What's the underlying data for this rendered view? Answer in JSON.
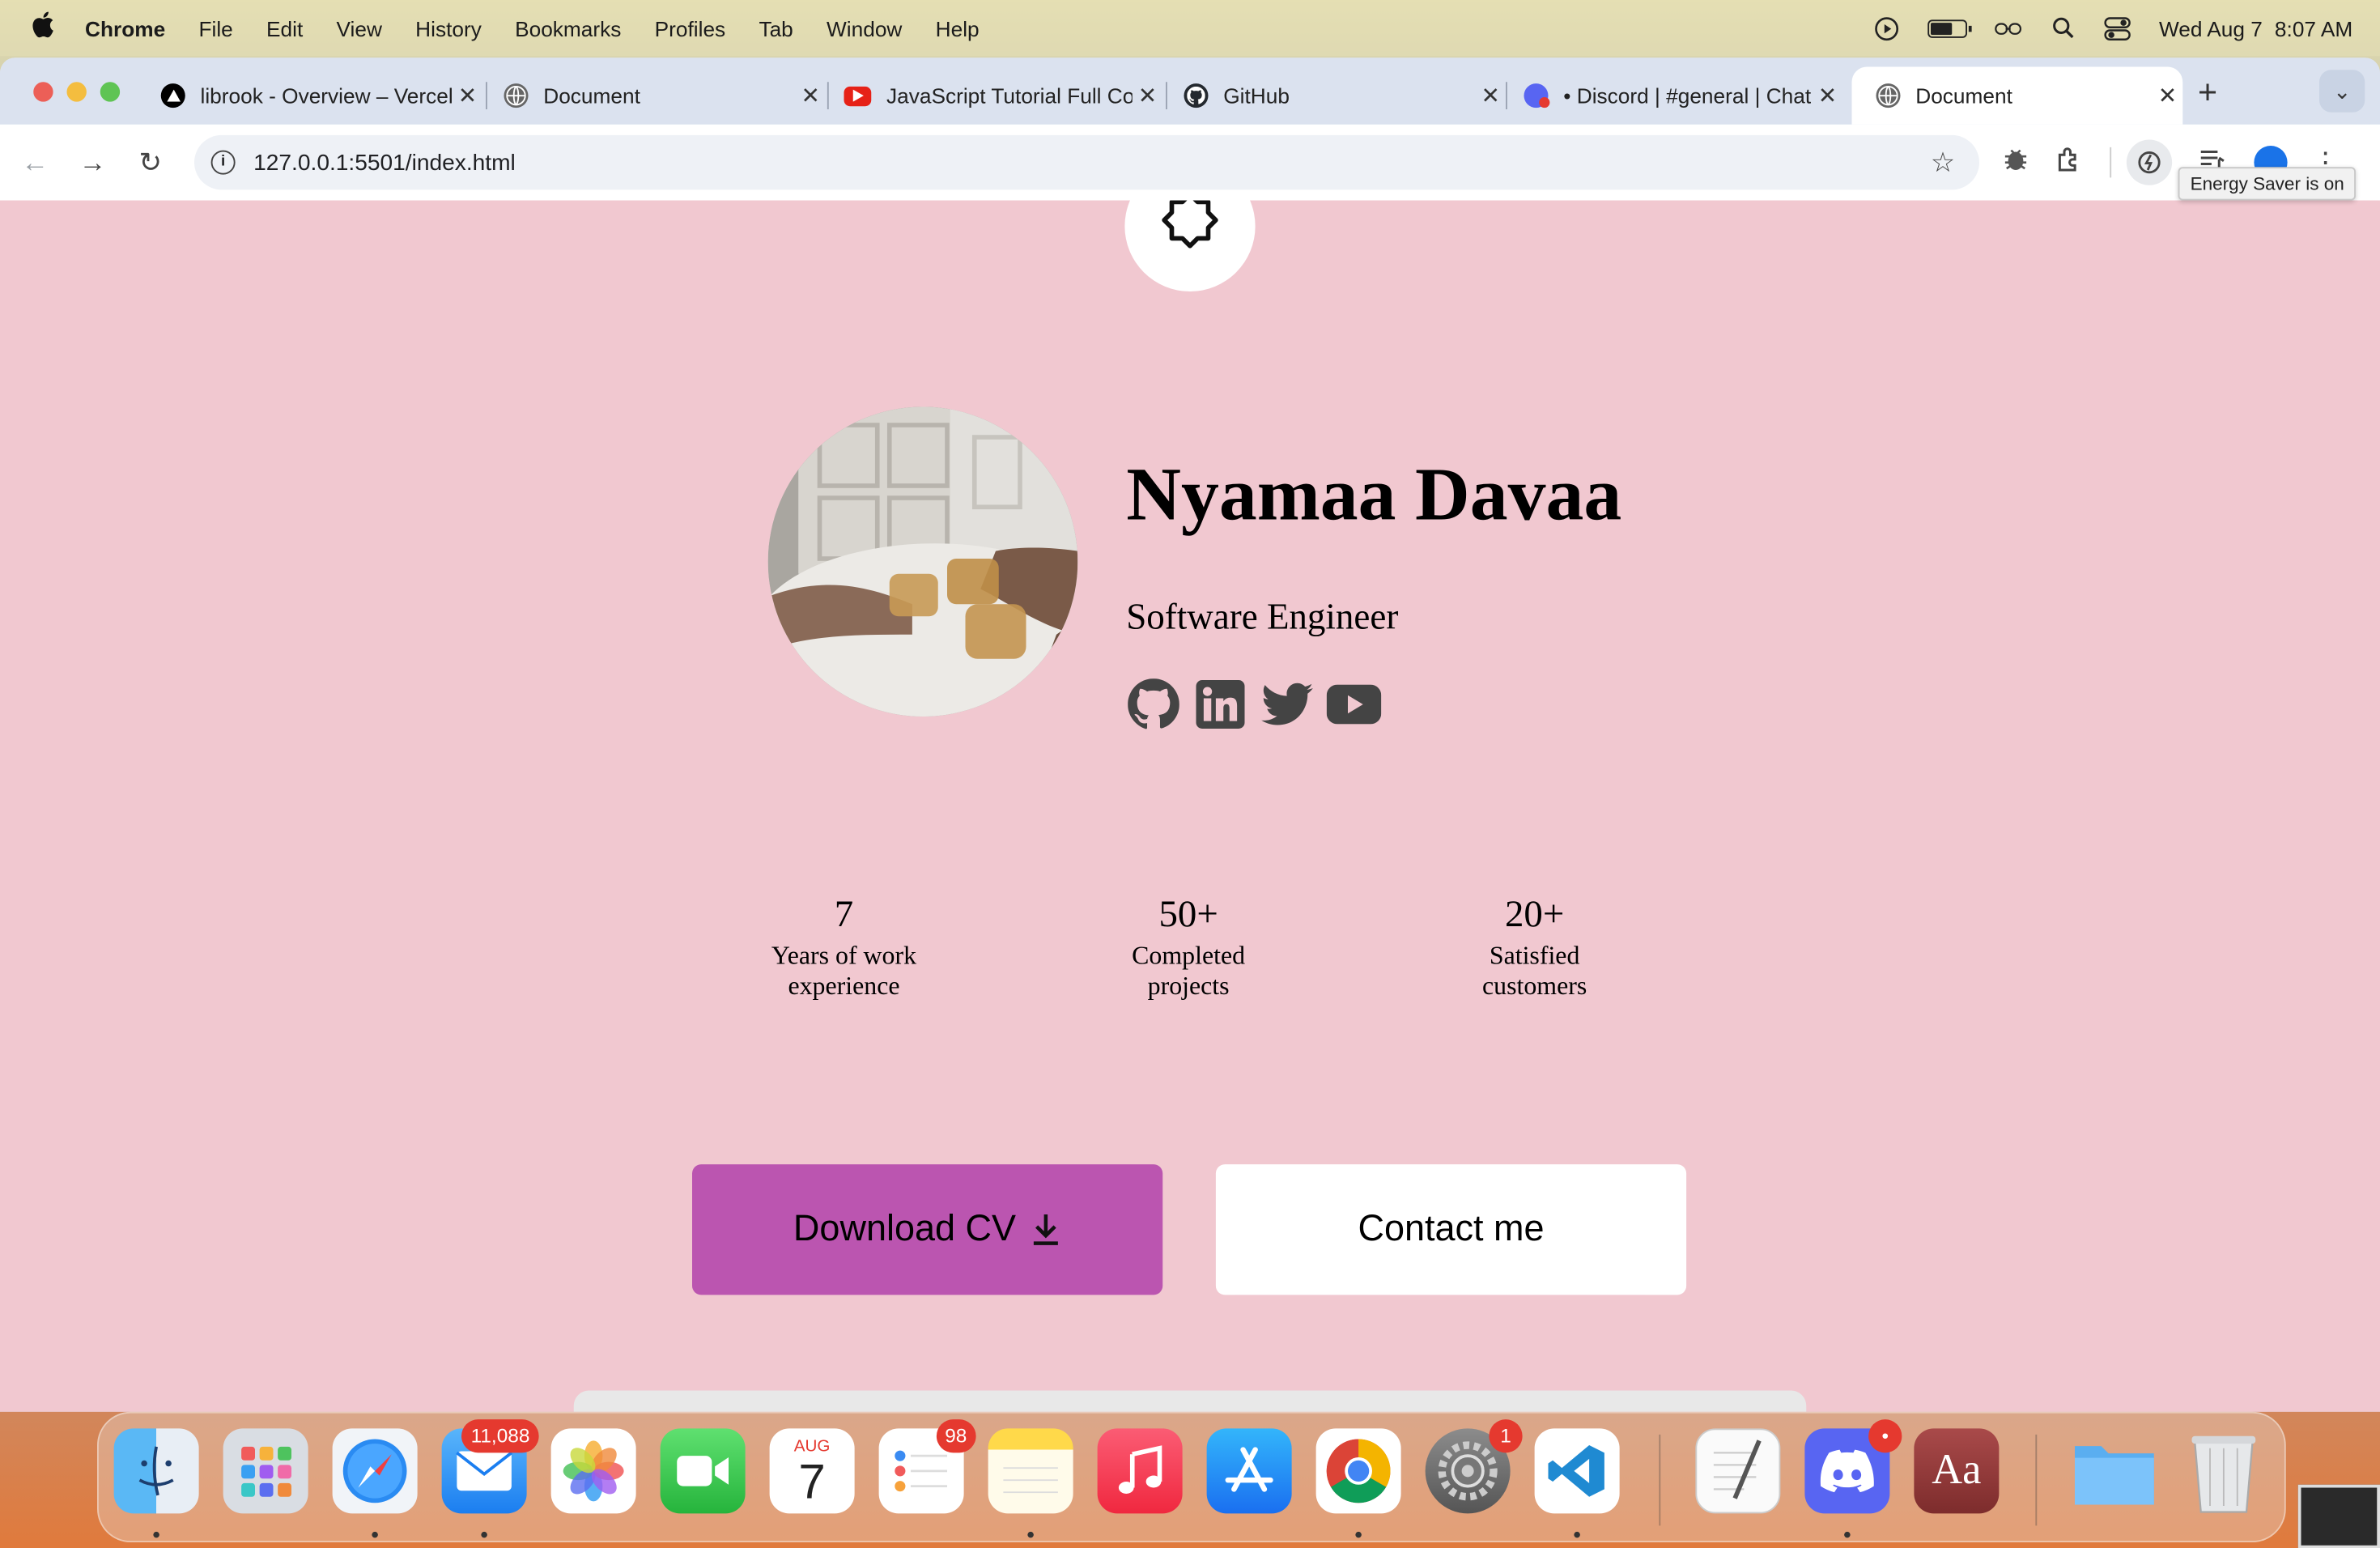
{
  "menubar": {
    "app_name": "Chrome",
    "items": [
      "File",
      "Edit",
      "View",
      "History",
      "Bookmarks",
      "Profiles",
      "Tab",
      "Window",
      "Help"
    ],
    "date": "Wed Aug 7",
    "time": "8:07 AM",
    "battery_level": 0.6
  },
  "tabs": [
    {
      "title": "librook - Overview – Vercel",
      "icon": "vercel-icon"
    },
    {
      "title": "Document",
      "icon": "globe-icon"
    },
    {
      "title": "JavaScript Tutorial Full Course",
      "icon": "youtube-icon"
    },
    {
      "title": "GitHub",
      "icon": "github-icon"
    },
    {
      "title": "• Discord | #general | Chat",
      "icon": "discord-icon"
    },
    {
      "title": "Document",
      "icon": "globe-icon",
      "active": true
    }
  ],
  "address_bar": {
    "url": "127.0.0.1:5501/index.html"
  },
  "tooltip": "Energy Saver is on",
  "page": {
    "name": "Nyamaa Davaa",
    "role": "Software Engineer",
    "socials": [
      "github-icon",
      "linkedin-icon",
      "twitter-icon",
      "youtube-icon"
    ],
    "stats": [
      {
        "value": "7",
        "label_line1": "Years of work",
        "label_line2": "experience"
      },
      {
        "value": "50+",
        "label_line1": "Completed",
        "label_line2": "projects"
      },
      {
        "value": "20+",
        "label_line1": "Satisfied",
        "label_line2": "customers"
      }
    ],
    "buttons": {
      "download_cv": "Download CV",
      "contact": "Contact me"
    },
    "colors": {
      "background": "#f1c8d0",
      "download_button": "#bb55b0",
      "contact_button": "#ffffff"
    }
  },
  "dock": {
    "apps": [
      {
        "name": "Finder",
        "icon": "finder-icon",
        "running": true
      },
      {
        "name": "Launchpad",
        "icon": "launchpad-icon"
      },
      {
        "name": "Safari",
        "icon": "safari-icon",
        "running": true
      },
      {
        "name": "Mail",
        "icon": "mail-icon",
        "badge": "11,088",
        "running": true
      },
      {
        "name": "Photos",
        "icon": "photos-icon"
      },
      {
        "name": "FaceTime",
        "icon": "facetime-icon"
      },
      {
        "name": "Calendar",
        "icon": "calendar-icon",
        "month": "AUG",
        "day": "7"
      },
      {
        "name": "Reminders",
        "icon": "reminders-icon",
        "badge": "98"
      },
      {
        "name": "Notes",
        "icon": "notes-icon",
        "running": true
      },
      {
        "name": "Music",
        "icon": "music-icon"
      },
      {
        "name": "App Store",
        "icon": "appstore-icon"
      },
      {
        "name": "Chrome",
        "icon": "chrome-icon",
        "running": true
      },
      {
        "name": "System Settings",
        "icon": "settings-icon",
        "badge": "1"
      },
      {
        "name": "VS Code",
        "icon": "vscode-icon",
        "running": true
      },
      {
        "name": "TextEdit",
        "icon": "textedit-icon"
      },
      {
        "name": "Discord",
        "icon": "discord-icon",
        "badge": "•",
        "running": true
      },
      {
        "name": "Dictionary",
        "icon": "dictionary-icon",
        "label": "Aa"
      },
      {
        "name": "Downloads",
        "icon": "folder-icon"
      },
      {
        "name": "Trash",
        "icon": "trash-icon"
      }
    ]
  }
}
